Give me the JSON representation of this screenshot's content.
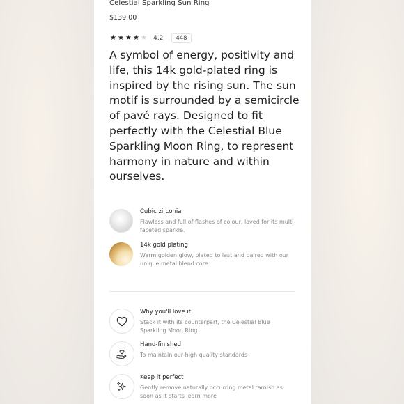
{
  "product": {
    "title": "Celestial Sparkling Sun Ring",
    "price": "$139.00",
    "rating": {
      "stars_filled": 4,
      "stars_total": 5,
      "value": "4.2",
      "review_count": "448"
    },
    "description": "A symbol of energy, positivity and life, this 14k gold-plated ring is inspired by the rising sun. The sun motif is surrounded by a semicircle of pavé rays. Designed to fit perfectly with the Celestial Blue Sparkling Moon Ring, to represent harmony in nature and within ourselves."
  },
  "materials": [
    {
      "title": "Cubic zirconia",
      "description": "Flawless and full of flashes of colour, loved for its multi-faceted sparkle.",
      "swatch_color": "#dcdcdc"
    },
    {
      "title": "14k gold plating",
      "description": "Warm golden glow, plated to last and paired with our unique metal blend core.",
      "swatch_color": "#d6a95a"
    }
  ],
  "features": [
    {
      "title": "Why you'll love it",
      "description": "Stack it with its counterpart, the Celestial Blue Sparkling Moon Ring.",
      "icon": "heart-icon"
    },
    {
      "title": "Hand-finished",
      "description": "To maintain our high quality standards",
      "icon": "hand-heart-icon"
    },
    {
      "title": "Keep it perfect",
      "description": "Gently remove naturally occurring metal tarnish as soon as it starts learn more",
      "icon": "sparkle-icon"
    }
  ],
  "colors": {
    "star_filled": "#222222",
    "star_empty": "#d4d4d4",
    "muted_text": "#888888"
  }
}
